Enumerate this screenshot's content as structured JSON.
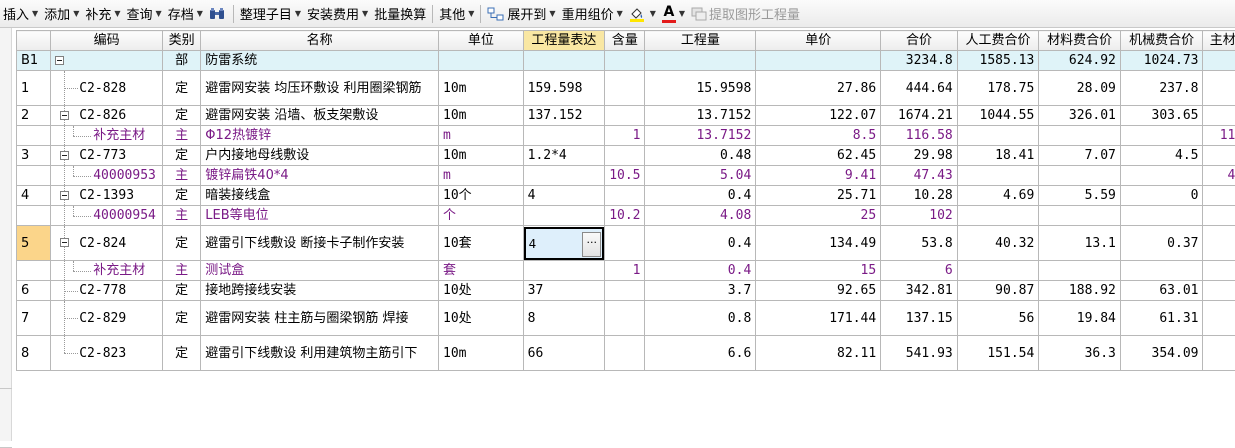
{
  "toolbar": {
    "insert": "插入",
    "add": "添加",
    "supplement": "补充",
    "query": "查询",
    "save": "存档",
    "organize": "整理子目",
    "install_fee": "安装费用",
    "batch_convert": "批量换算",
    "other": "其他",
    "expand_to": "展开到",
    "reuse_price": "重用组价",
    "extract_quantity": "提取图形工程量",
    "icons": [
      "binoculars-icon",
      "expand-tree-icon",
      "fill-color-icon",
      "font-color-icon",
      "extract-graphic-icon"
    ]
  },
  "columns": [
    "编码",
    "类别",
    "名称",
    "单位",
    "工程量表达",
    "含量",
    "工程量",
    "单价",
    "合价",
    "人工费合价",
    "材料费合价",
    "机械费合价",
    "主材费"
  ],
  "rows": [
    {
      "num": "B1",
      "code": "",
      "cat": "部",
      "name": "防雷系统",
      "unit": "",
      "expr": "",
      "content": "",
      "qty": "",
      "price": "",
      "total": "3234.8",
      "labor": "1585.13",
      "material": "624.92",
      "machine": "1024.73",
      "main": "2"
    },
    {
      "num": "1",
      "code": "C2-828",
      "cat": "定",
      "name": "避雷网安装 均压环敷设 利用圈梁钢筋",
      "unit": "10m",
      "expr": "159.598",
      "content": "",
      "qty": "15.9598",
      "price": "27.86",
      "total": "444.64",
      "labor": "178.75",
      "material": "28.09",
      "machine": "237.8",
      "main": ""
    },
    {
      "num": "2",
      "code": "C2-826",
      "cat": "定",
      "name": "避雷网安装 沿墙、板支架敷设",
      "unit": "10m",
      "expr": "137.152",
      "content": "",
      "qty": "13.7152",
      "price": "122.07",
      "total": "1674.21",
      "labor": "1044.55",
      "material": "326.01",
      "machine": "303.65",
      "main": "1"
    },
    {
      "num": "",
      "code": "补充主材",
      "cat": "主",
      "name": "Φ12热镀锌",
      "unit": "m",
      "expr": "",
      "content": "1",
      "qty": "13.7152",
      "price": "8.5",
      "total": "116.58",
      "labor": "",
      "material": "",
      "machine": "",
      "main": "116."
    },
    {
      "num": "3",
      "code": "C2-773",
      "cat": "定",
      "name": "户内接地母线敷设",
      "unit": "10m",
      "expr": "1.2*4",
      "content": "",
      "qty": "0.48",
      "price": "62.45",
      "total": "29.98",
      "labor": "18.41",
      "material": "7.07",
      "machine": "4.5",
      "main": ""
    },
    {
      "num": "",
      "code": "40000953",
      "cat": "主",
      "name": "镀锌扁铁40*4",
      "unit": "m",
      "expr": "",
      "content": "10.5",
      "qty": "5.04",
      "price": "9.41",
      "total": "47.43",
      "labor": "",
      "material": "",
      "machine": "",
      "main": "47."
    },
    {
      "num": "4",
      "code": "C2-1393",
      "cat": "定",
      "name": "暗装接线盒",
      "unit": "10个",
      "expr": "4",
      "content": "",
      "qty": "0.4",
      "price": "25.71",
      "total": "10.28",
      "labor": "4.69",
      "material": "5.59",
      "machine": "0",
      "main": ""
    },
    {
      "num": "",
      "code": "40000954",
      "cat": "主",
      "name": "LEB等电位",
      "unit": "个",
      "expr": "",
      "content": "10.2",
      "qty": "4.08",
      "price": "25",
      "total": "102",
      "labor": "",
      "material": "",
      "machine": "",
      "main": ""
    },
    {
      "num": "5",
      "code": "C2-824",
      "cat": "定",
      "name": "避雷引下线敷设 断接卡子制作安装",
      "unit": "10套",
      "expr": "4",
      "content": "",
      "qty": "0.4",
      "price": "134.49",
      "total": "53.8",
      "labor": "40.32",
      "material": "13.1",
      "machine": "0.37",
      "main": ""
    },
    {
      "num": "",
      "code": "补充主材",
      "cat": "主",
      "name": "测试盒",
      "unit": "套",
      "expr": "",
      "content": "1",
      "qty": "0.4",
      "price": "15",
      "total": "6",
      "labor": "",
      "material": "",
      "machine": "",
      "main": ""
    },
    {
      "num": "6",
      "code": "C2-778",
      "cat": "定",
      "name": "接地跨接线安装",
      "unit": "10处",
      "expr": "37",
      "content": "",
      "qty": "3.7",
      "price": "92.65",
      "total": "342.81",
      "labor": "90.87",
      "material": "188.92",
      "machine": "63.01",
      "main": ""
    },
    {
      "num": "7",
      "code": "C2-829",
      "cat": "定",
      "name": "避雷网安装 柱主筋与圈梁钢筋 焊接",
      "unit": "10处",
      "expr": "8",
      "content": "",
      "qty": "0.8",
      "price": "171.44",
      "total": "137.15",
      "labor": "56",
      "material": "19.84",
      "machine": "61.31",
      "main": ""
    },
    {
      "num": "8",
      "code": "C2-823",
      "cat": "定",
      "name": "避雷引下线敷设 利用建筑物主筋引下",
      "unit": "10m",
      "expr": "66",
      "content": "",
      "qty": "6.6",
      "price": "82.11",
      "total": "541.93",
      "labor": "151.54",
      "material": "36.3",
      "machine": "354.09",
      "main": ""
    }
  ],
  "ellipsis": "···",
  "colors": {
    "selected_row": "#fbd58a",
    "group_row": "#dff3f8",
    "highlight_header": "#f9e7a3",
    "material_text": "#7a1a86",
    "edit_cell": "#deeffb"
  }
}
